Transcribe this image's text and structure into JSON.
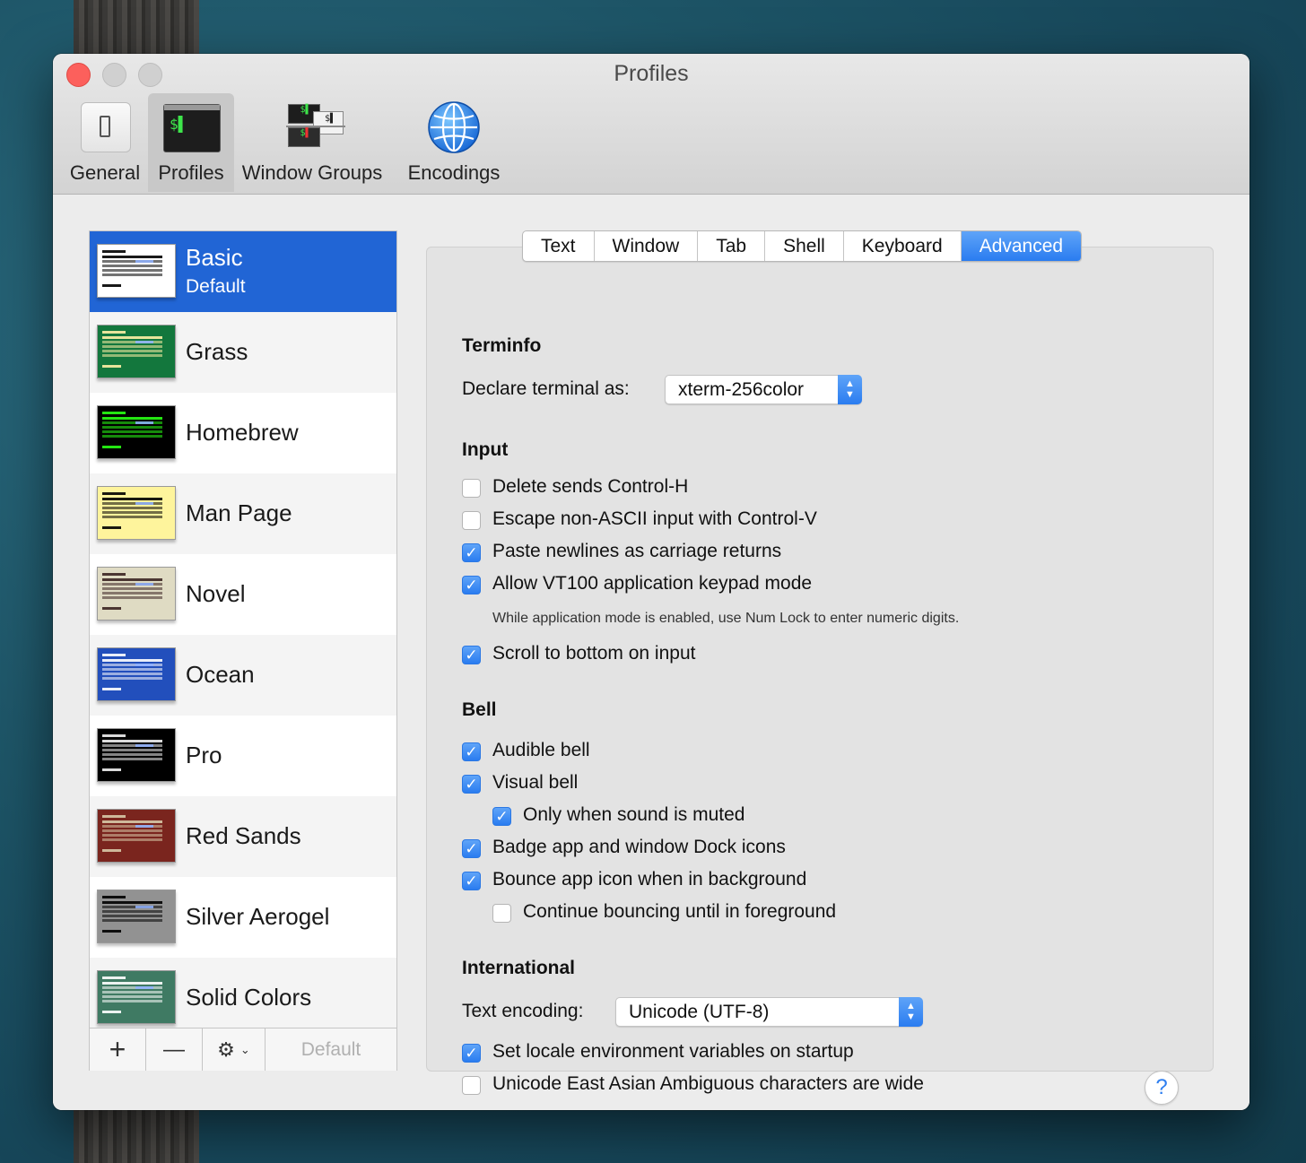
{
  "window": {
    "title": "Profiles"
  },
  "toolbar": {
    "items": [
      {
        "label": "General",
        "icon": "general-switch-icon"
      },
      {
        "label": "Profiles",
        "icon": "profiles-terminal-icon"
      },
      {
        "label": "Window Groups",
        "icon": "window-groups-icon"
      },
      {
        "label": "Encodings",
        "icon": "globe-icon"
      }
    ],
    "active": "Profiles"
  },
  "profiles": {
    "items": [
      {
        "name": "Basic",
        "subtitle": "Default",
        "thumb_bg": "#ffffff",
        "thumb_fg": "#000000"
      },
      {
        "name": "Grass",
        "thumb_bg": "#13773d",
        "thumb_fg": "#fff0a5"
      },
      {
        "name": "Homebrew",
        "thumb_bg": "#000000",
        "thumb_fg": "#28fe14"
      },
      {
        "name": "Man Page",
        "thumb_bg": "#fef49c",
        "thumb_fg": "#000000"
      },
      {
        "name": "Novel",
        "thumb_bg": "#dfdbc3",
        "thumb_fg": "#3b2322"
      },
      {
        "name": "Ocean",
        "thumb_bg": "#224fbc",
        "thumb_fg": "#ffffff"
      },
      {
        "name": "Pro",
        "thumb_bg": "#000000",
        "thumb_fg": "#f2f2f2"
      },
      {
        "name": "Red Sands",
        "thumb_bg": "#7a251e",
        "thumb_fg": "#d7c9a7"
      },
      {
        "name": "Silver Aerogel",
        "thumb_bg": "#929292",
        "thumb_fg": "#000000"
      },
      {
        "name": "Solid Colors",
        "thumb_bg": "#3f7a63",
        "thumb_fg": "#ffffff"
      }
    ],
    "selected": "Basic",
    "bottom_bar": {
      "add": "+",
      "remove": "—",
      "gear": "⚙",
      "default_label": "Default"
    }
  },
  "tabs": {
    "items": [
      "Text",
      "Window",
      "Tab",
      "Shell",
      "Keyboard",
      "Advanced"
    ],
    "active": "Advanced"
  },
  "advanced": {
    "terminfo": {
      "title": "Terminfo",
      "declare_label": "Declare terminal as:",
      "declare_value": "xterm-256color"
    },
    "input": {
      "title": "Input",
      "delete_sends": {
        "label": "Delete sends Control-H",
        "checked": false
      },
      "escape_non_ascii": {
        "label": "Escape non-ASCII input with Control-V",
        "checked": false
      },
      "paste_newlines": {
        "label": "Paste newlines as carriage returns",
        "checked": true
      },
      "vt100_keypad": {
        "label": "Allow VT100 application keypad mode",
        "checked": true
      },
      "vt100_note": "While application mode is enabled, use Num Lock to enter numeric digits.",
      "scroll_bottom": {
        "label": "Scroll to bottom on input",
        "checked": true
      }
    },
    "bell": {
      "title": "Bell",
      "audible": {
        "label": "Audible bell",
        "checked": true
      },
      "visual": {
        "label": "Visual bell",
        "checked": true
      },
      "only_muted": {
        "label": "Only when sound is muted",
        "checked": true
      },
      "badge": {
        "label": "Badge app and window Dock icons",
        "checked": true
      },
      "bounce": {
        "label": "Bounce app icon when in background",
        "checked": true
      },
      "continue_bounce": {
        "label": "Continue bouncing until in foreground",
        "checked": false
      }
    },
    "international": {
      "title": "International",
      "encoding_label": "Text encoding:",
      "encoding_value": "Unicode (UTF-8)",
      "set_locale": {
        "label": "Set locale environment variables on startup",
        "checked": true
      },
      "east_asian": {
        "label": "Unicode East Asian Ambiguous characters are wide",
        "checked": false
      }
    }
  },
  "help": {
    "label": "?"
  },
  "colors": {
    "accent": "#2a7cf0",
    "selection": "#2165d5",
    "close": "#fc605c"
  }
}
